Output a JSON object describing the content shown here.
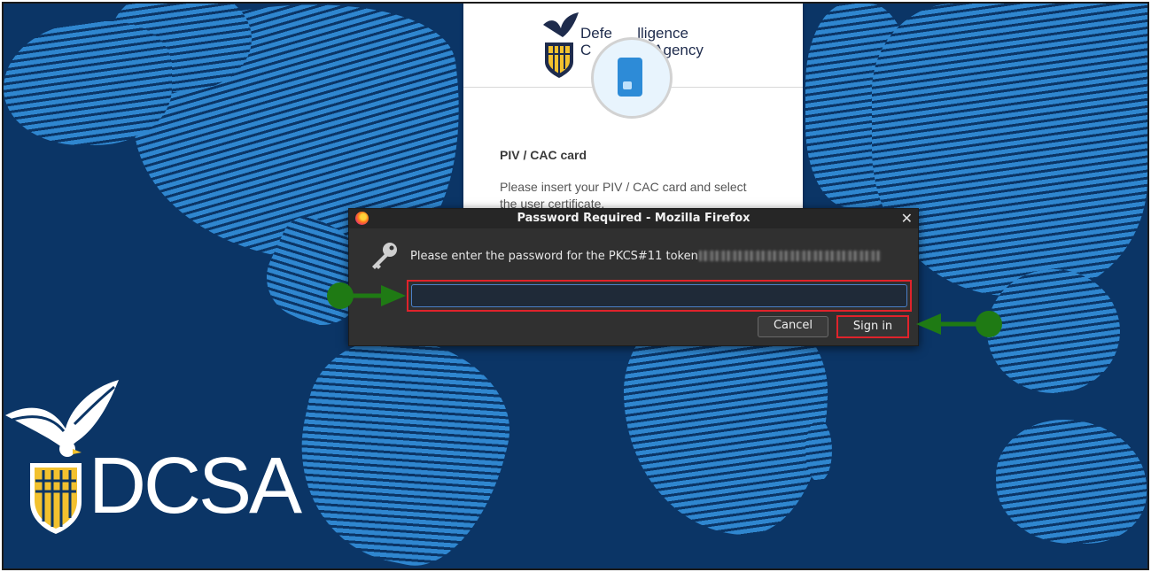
{
  "background": {
    "ocean_color": "#0b3566",
    "land_color": "#2f86cf"
  },
  "login_card": {
    "agency_name_line1": "Defe      lligence",
    "agency_name_line2": "C               Agency",
    "card_title": "PIV / CAC card",
    "card_description": "Please insert your PIV / CAC card and select the user certificate."
  },
  "dialog": {
    "title": "Password Required - Mozilla Firefox",
    "close_glyph": "✕",
    "prompt": "Please enter the password for the PKCS#11 token",
    "password_value": "",
    "cancel_label": "Cancel",
    "signin_label": "Sign in",
    "highlight_color": "#e0232b"
  },
  "annotations": {
    "arrow_color": "#1f7a14"
  },
  "logo": {
    "text": "DCSA"
  }
}
